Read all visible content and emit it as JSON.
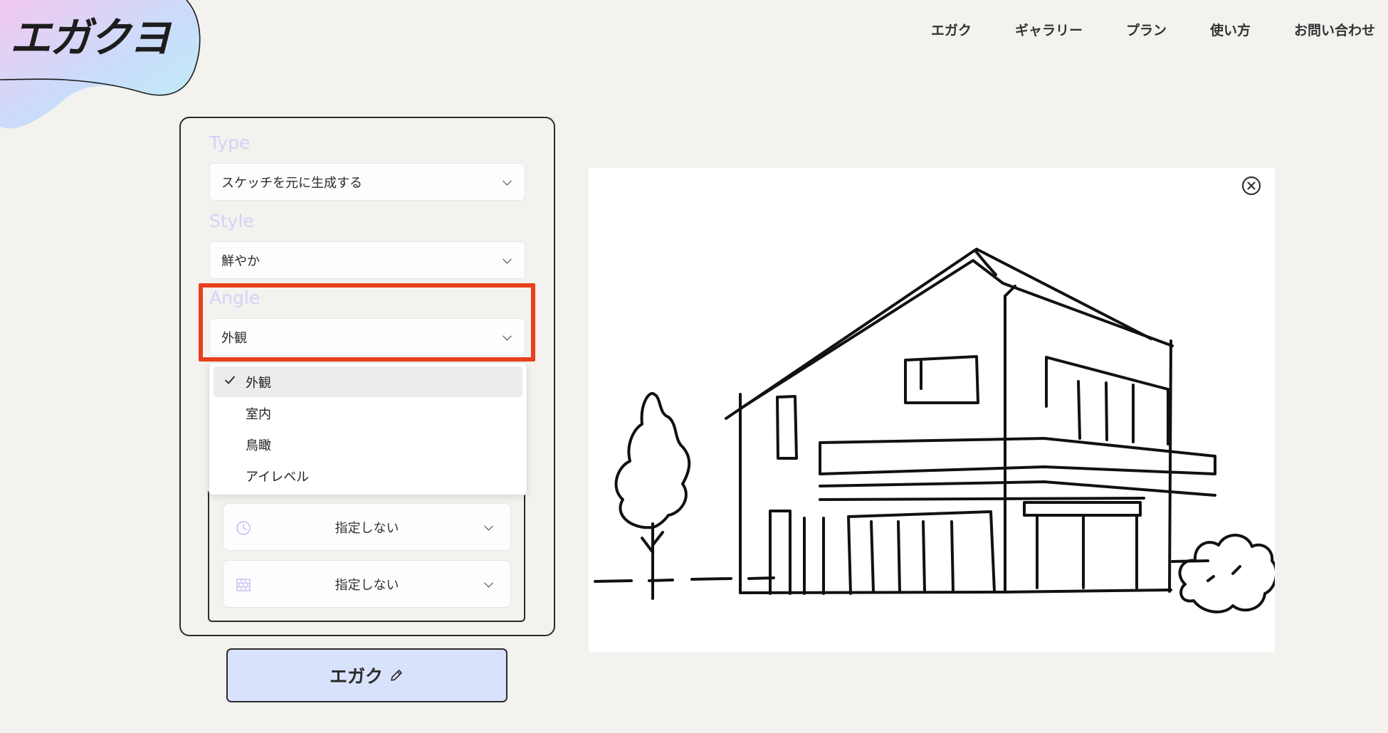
{
  "brand": {
    "logo_text": "エガクヨ"
  },
  "nav": {
    "items": [
      {
        "label": "エガク"
      },
      {
        "label": "ギャラリー"
      },
      {
        "label": "プラン"
      },
      {
        "label": "使い方"
      },
      {
        "label": "お問い合わせ"
      }
    ]
  },
  "form": {
    "type": {
      "label": "Type",
      "value": "スケッチを元に生成する"
    },
    "style": {
      "label": "Style",
      "value": "鮮やか"
    },
    "angle": {
      "label": "Angle",
      "value": "外観",
      "options": [
        "外観",
        "室内",
        "鳥瞰",
        "アイレベル"
      ],
      "selected_option": "外観"
    },
    "time": {
      "value": "指定しない",
      "icon": "clock-icon"
    },
    "material": {
      "value": "指定しない",
      "icon": "brick-icon"
    },
    "submit_label": "エガク"
  },
  "colors": {
    "background": "#f3f2ef",
    "label": "#d4d2f7",
    "button": "#d9e2fb",
    "highlight": "#e8401c"
  }
}
